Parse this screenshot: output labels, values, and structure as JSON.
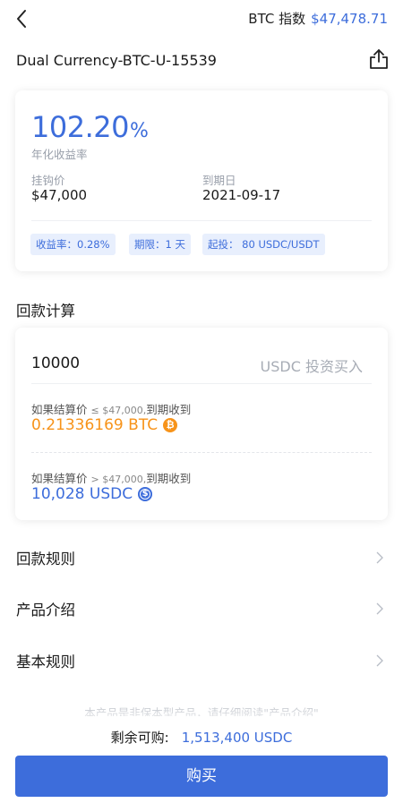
{
  "header": {
    "index_label": "BTC 指数",
    "index_value": "$47,478.71"
  },
  "product": {
    "title": "Dual Currency-BTC-U-15539"
  },
  "summary": {
    "rate_value": "102.20",
    "rate_unit": "%",
    "rate_label": "年化收益率",
    "strike_label": "挂钩价",
    "strike_value": "$47,000",
    "expiry_label": "到期日",
    "expiry_value": "2021-09-17",
    "tags": [
      "收益率：0.28%",
      "期限：1 天",
      "起投： 80 USDC/USDT"
    ]
  },
  "calc": {
    "section_title": "回款计算",
    "amount_value": "10000",
    "amount_hint": "USDC 投资买入",
    "case1": {
      "prefix": "如果结算价",
      "op": "≤ $47,000,",
      "suffix": "到期收到",
      "result": "0.21336169 BTC"
    },
    "case2": {
      "prefix": "如果结算价",
      "op": "> $47,000,",
      "suffix": "到期收到",
      "result": "10,028 USDC"
    }
  },
  "menu": [
    {
      "label": "回款规则"
    },
    {
      "label": "产品介绍"
    },
    {
      "label": "基本规则"
    }
  ],
  "footer": {
    "notice": "本产品是非保本型产品，请仔细阅读\"产品介绍\"",
    "available_label": "剩余可购:",
    "available_value": "1,513,400 USDC",
    "buy_label": "购买"
  },
  "colors": {
    "accent": "#3d6ddb",
    "btc": "#f7931a",
    "tag_bg": "#e8effd"
  },
  "icons": [
    "back-arrow-icon",
    "share-icon",
    "bitcoin-icon",
    "usdc-icon",
    "chevron-right-icon"
  ]
}
